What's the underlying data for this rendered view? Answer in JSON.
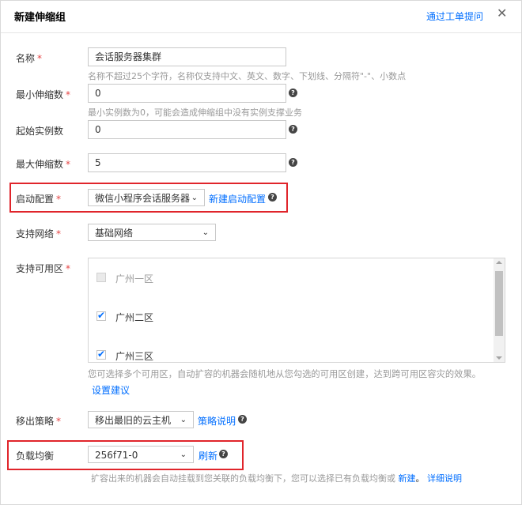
{
  "header": {
    "title": "新建伸缩组",
    "help_link": "通过工单提问",
    "close_glyph": "✕"
  },
  "required_mark": "*",
  "question_glyph": "?",
  "chevron_glyph": "⌄",
  "check_glyph": "✔",
  "form": {
    "name": {
      "label": "名称",
      "value": "会话服务器集群",
      "hint": "名称不超过25个字符，名称仅支持中文、英文、数字、下划线、分隔符\"-\"、小数点"
    },
    "min_size": {
      "label": "最小伸缩数",
      "value": "0",
      "hint": "最小实例数为0，可能会造成伸缩组中没有实例支撑业务"
    },
    "initial_size": {
      "label": "起始实例数",
      "value": "0"
    },
    "max_size": {
      "label": "最大伸缩数",
      "value": "5"
    },
    "launch_config": {
      "label": "启动配置",
      "selected": "微信小程序会话服务器",
      "new_link": "新建启动配置"
    },
    "network": {
      "label": "支持网络",
      "selected": "基础网络"
    },
    "zones": {
      "label": "支持可用区",
      "items": [
        {
          "label": "广州一区",
          "checked": false,
          "disabled": true
        },
        {
          "label": "广州二区",
          "checked": true,
          "disabled": false
        },
        {
          "label": "广州三区",
          "checked": true,
          "disabled": false
        }
      ],
      "description": "您可选择多个可用区，自动扩容的机器会随机地从您勾选的可用区创建，达到跨可用区容灾的效果。",
      "settings_link": "设置建议"
    },
    "removal_policy": {
      "label": "移出策略",
      "selected": "移出最旧的云主机",
      "policy_link": "策略说明"
    },
    "load_balancer": {
      "label": "负载均衡",
      "selected": "256f71-0",
      "refresh_link": "刷新",
      "description": "扩容出来的机器会自动挂载到您关联的负载均衡下，您可以选择已有负载均衡或",
      "new_link": "新建",
      "detail_link": "详细说明"
    }
  },
  "colors": {
    "highlight": "#e0252b",
    "link": "#006eff",
    "required": "#e54545"
  }
}
